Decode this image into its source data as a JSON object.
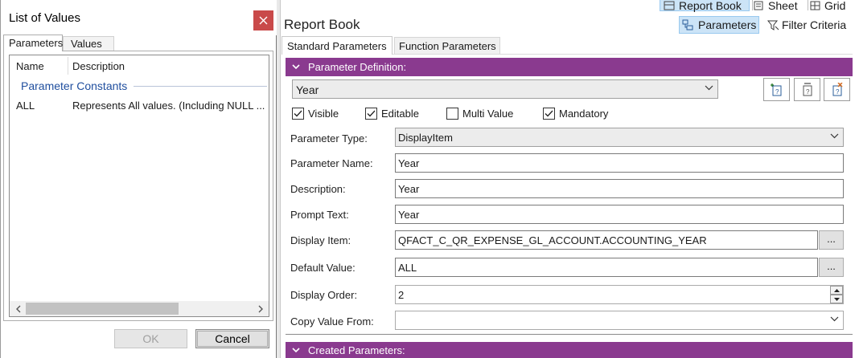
{
  "lov_dialog": {
    "title": "List of Values",
    "tabs": [
      "Parameters",
      "Values"
    ],
    "columns": [
      "Name",
      "Description"
    ],
    "group_label": "Parameter Constants",
    "rows": [
      {
        "name": "ALL",
        "description": "Represents All values. (Including NULL ..."
      }
    ],
    "ok_label": "OK",
    "cancel_label": "Cancel"
  },
  "right": {
    "view_buttons": [
      "Report Book",
      "Sheet",
      "Grid"
    ],
    "title": "Report Book",
    "parameters_label": "Parameters",
    "filter_label": "Filter Criteria",
    "tabs": [
      "Standard Parameters",
      "Function Parameters"
    ],
    "section_definition": "Parameter Definition:",
    "section_created": "Created Parameters:",
    "selected_parameter": "Year",
    "checkboxes": [
      {
        "label": "Visible",
        "checked": true
      },
      {
        "label": "Editable",
        "checked": true
      },
      {
        "label": "Multi Value",
        "checked": false
      },
      {
        "label": "Mandatory",
        "checked": true
      }
    ],
    "fields": {
      "parameter_type": {
        "label": "Parameter Type:",
        "value": "DisplayItem"
      },
      "parameter_name": {
        "label": "Parameter Name:",
        "value": "Year"
      },
      "description": {
        "label": "Description:",
        "value": "Year"
      },
      "prompt_text": {
        "label": "Prompt Text:",
        "value": "Year"
      },
      "display_item": {
        "label": "Display Item:",
        "value": "QFACT_C_QR_EXPENSE_GL_ACCOUNT.ACCOUNTING_YEAR"
      },
      "default_value": {
        "label": "Default Value:",
        "value": "ALL"
      },
      "display_order": {
        "label": "Display Order:",
        "value": "2"
      },
      "copy_value_from": {
        "label": "Copy Value From:",
        "value": ""
      }
    },
    "ellipsis_label": "...",
    "colors": {
      "section_bar": "#8a3a8f",
      "selected_button": "#cce4f7",
      "group_label": "#1f4e9e"
    }
  }
}
